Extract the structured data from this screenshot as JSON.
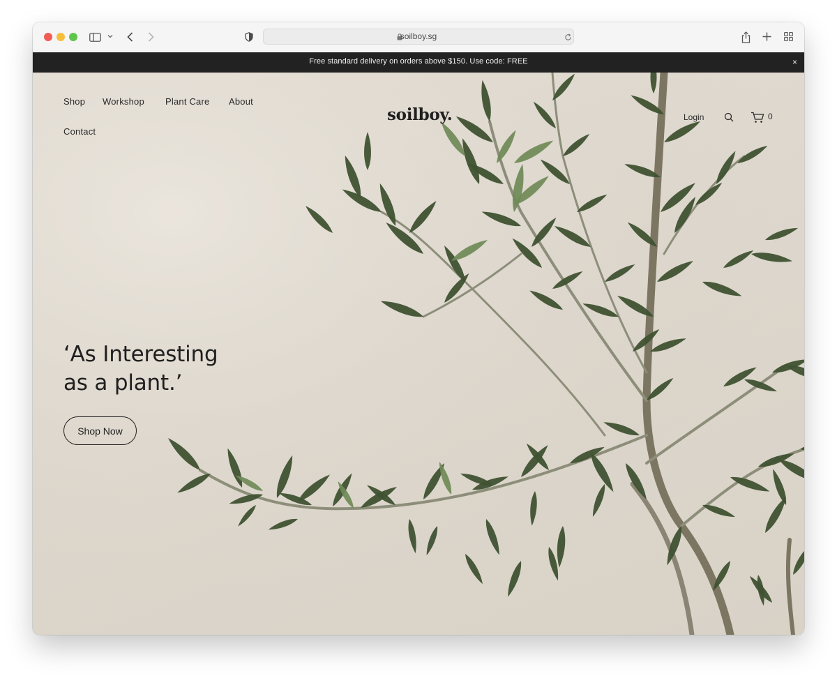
{
  "browser": {
    "url": "soilboy.sg"
  },
  "announcement": {
    "text": "Free standard delivery on orders above $150. Use code: FREE",
    "close": "×"
  },
  "nav": {
    "shop": "Shop",
    "workshop": "Workshop",
    "plant_care": "Plant Care",
    "about": "About",
    "contact": "Contact"
  },
  "header": {
    "logo": "soilboy.",
    "login": "Login",
    "cart_count": "0"
  },
  "hero": {
    "headline_line1": "‘As Interesting",
    "headline_line2": "as a plant.’",
    "cta": "Shop Now"
  },
  "colors": {
    "background": "#ded8cf",
    "leaf_dark": "#3f5232",
    "leaf_light": "#6f8a57",
    "stem": "#8d8e7a",
    "text": "#1f1f1f",
    "announcement_bar": "#222222"
  }
}
